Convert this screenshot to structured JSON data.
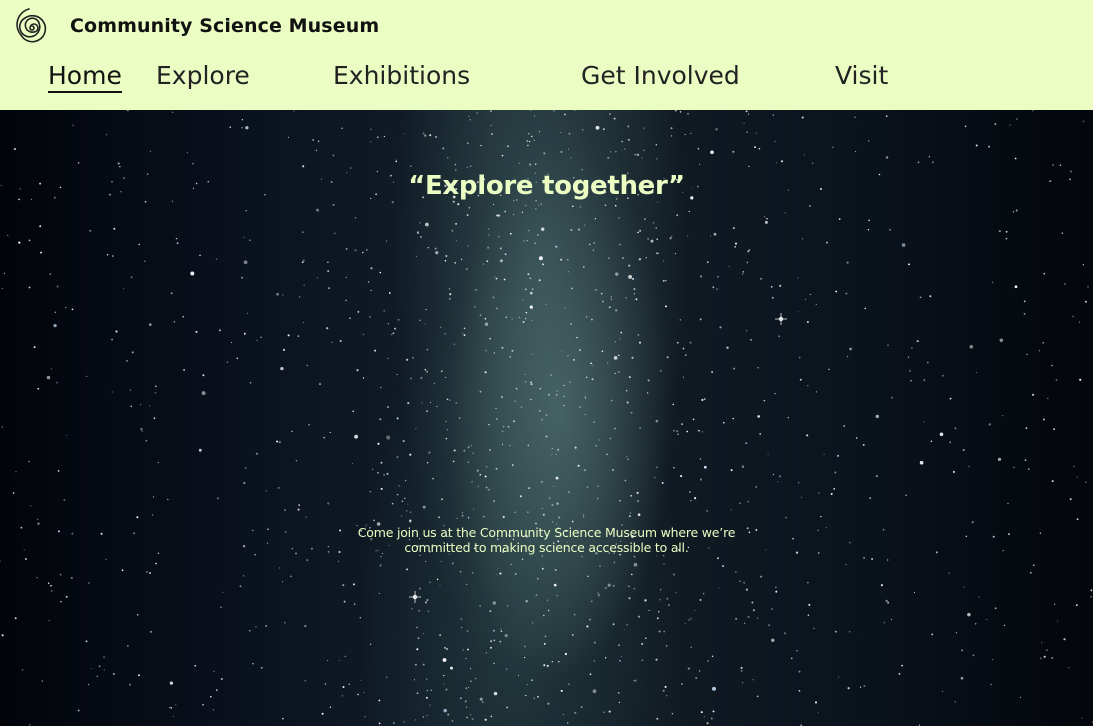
{
  "header": {
    "site_title": "Community Science Museum",
    "background_color": "#ebfdc3",
    "logo_icon": "spiral-icon"
  },
  "nav": {
    "items": [
      {
        "label": "Home",
        "active": true
      },
      {
        "label": "Explore",
        "active": false
      },
      {
        "label": "Exhibitions",
        "active": false
      },
      {
        "label": "Get Involved",
        "active": false
      },
      {
        "label": "Visit",
        "active": false
      }
    ]
  },
  "hero": {
    "heading": "“Explore together”",
    "text": "Come join us at the Community Science Museum where we’re committed to making science accessible to all.",
    "text_color": "#ebfdc3",
    "background": "starry-night-sky-milky-way"
  }
}
